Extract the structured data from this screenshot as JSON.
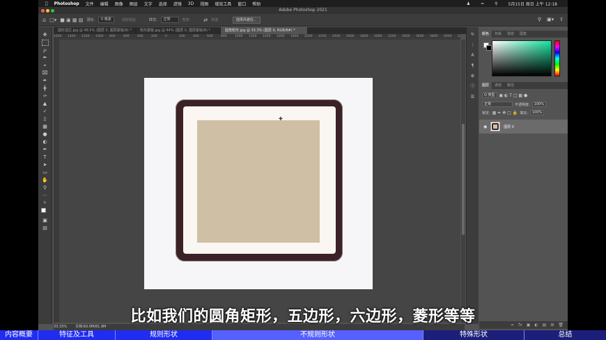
{
  "menubar": {
    "app": "Photoshop",
    "items": [
      "文件",
      "编辑",
      "图像",
      "图层",
      "文字",
      "选择",
      "滤镜",
      "3D",
      "视图",
      "增效工具",
      "窗口",
      "帮助"
    ],
    "clock": "5月15日 周日 上午 12:18"
  },
  "window": {
    "title": "Adobe Photoshop 2021"
  },
  "options": {
    "feather_label": "羽化:",
    "feather_value": "0 像素",
    "antialias": "消除锯齿",
    "style_label": "样式:",
    "style_value": "正常",
    "width_label": "宽度:",
    "height_label": "高度:",
    "select_mask": "选择并遮住..."
  },
  "tabs": [
    {
      "label": "圆形选区.jpg @ 48.5% (图层 0, 图层蒙版/8) *"
    },
    {
      "label": "矩形蒙版.jpg @ 44% (图层 0, 图层蒙版/8) *"
    },
    {
      "label": "圆角矩形.jpg @ 33.3% (图层 0, RGB/8#) *"
    }
  ],
  "ruler": [
    "1600",
    "1400",
    "1200",
    "1000",
    "800",
    "600",
    "400",
    "200",
    "0",
    "200",
    "400",
    "600",
    "800",
    "1000",
    "1200",
    "1400",
    "1600",
    "1800",
    "2000",
    "2200",
    "2400",
    "2600",
    "2800",
    "3000",
    "3200",
    "3400",
    "3600",
    "3800",
    "4000",
    "4200",
    "4400"
  ],
  "status": {
    "zoom": "33.33%",
    "doc": "文档:60.0M/81.9M"
  },
  "color_panel": {
    "tabs": [
      "颜色",
      "色板",
      "渐变",
      "图案"
    ]
  },
  "layers_panel": {
    "tabs": [
      "图层",
      "通道",
      "路径"
    ],
    "kind": "Q 类型",
    "blend_mode": "正常",
    "opacity_label": "不透明度:",
    "opacity_value": "100%",
    "lock_label": "锁定:",
    "fill_label": "填充:",
    "fill_value": "100%",
    "layer_name": "图层 0"
  },
  "subtitle": "比如我们的圆角矩形，五边形，六边形，菱形等等",
  "chapters": [
    {
      "label": "内容概要",
      "state": "done"
    },
    {
      "label": "特征及工具",
      "state": "done"
    },
    {
      "label": "规则形状",
      "state": "done"
    },
    {
      "label": "不规则形状",
      "state": "current"
    },
    {
      "label": "特殊形状",
      "state": "next"
    },
    {
      "label": "总结",
      "state": "next"
    }
  ],
  "colors": {
    "accent": "#202cf0",
    "current": "#5660ff",
    "frame": "#3b2226",
    "photo": "#cfc0a5"
  }
}
